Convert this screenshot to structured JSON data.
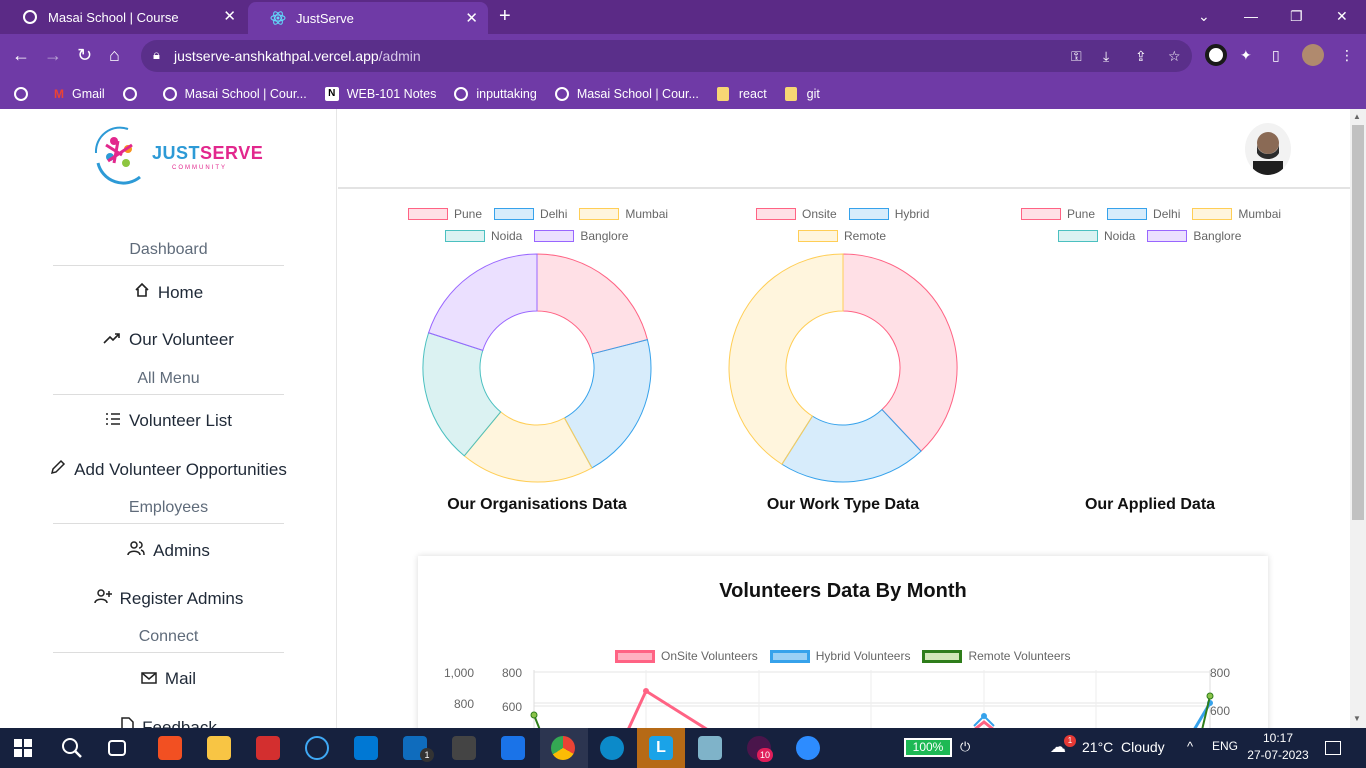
{
  "browser": {
    "tabs": [
      {
        "title": "Masai School | Course",
        "active": false
      },
      {
        "title": "JustServe",
        "active": true
      }
    ],
    "url_host": "justserve-anshkathpal.vercel.app",
    "url_path": "/admin",
    "bookmarks": [
      {
        "label": "Gmail",
        "icon": "gmail-icon"
      },
      {
        "label": "",
        "icon": "globe-icon"
      },
      {
        "label": "Masai School | Cour...",
        "icon": "globe-icon"
      },
      {
        "label": "WEB-101 Notes",
        "icon": "notion-icon"
      },
      {
        "label": "inputtaking",
        "icon": "globe-icon"
      },
      {
        "label": "Masai School | Cour...",
        "icon": "globe-icon"
      },
      {
        "label": "react",
        "icon": "folder-icon"
      },
      {
        "label": "git",
        "icon": "folder-icon"
      }
    ]
  },
  "sidebar": {
    "logo": {
      "brand_a": "JUST",
      "brand_b": "SERVE",
      "sub": "COMMUNITY"
    },
    "sections": [
      {
        "title": "Dashboard",
        "items": [
          {
            "label": "Home",
            "icon": "home-icon"
          },
          {
            "label": "Our Volunteer",
            "icon": "trend-icon"
          }
        ]
      },
      {
        "title": "All Menu",
        "items": [
          {
            "label": "Volunteer List",
            "icon": "list-icon"
          },
          {
            "label": "Add Volunteer Opportunities",
            "icon": "pencil-icon"
          }
        ]
      },
      {
        "title": "Employees",
        "items": [
          {
            "label": "Admins",
            "icon": "users-icon"
          },
          {
            "label": "Register Admins",
            "icon": "user-plus-icon"
          }
        ]
      },
      {
        "title": "Connect",
        "items": [
          {
            "label": "Mail",
            "icon": "mail-icon"
          },
          {
            "label": "Feedback",
            "icon": "file-icon"
          }
        ]
      }
    ]
  },
  "colors": {
    "pink": "#ff6384",
    "blue": "#36a2eb",
    "yellow": "#ffce56",
    "teal": "#4bc0c0",
    "purple": "#9966ff",
    "green": "#2e7d1a"
  },
  "chart_data": [
    {
      "type": "pie",
      "title": "Our Organisations Data",
      "categories": [
        "Pune",
        "Delhi",
        "Mumbai",
        "Noida",
        "Banglore"
      ],
      "values": [
        21,
        21,
        19,
        19,
        20
      ]
    },
    {
      "type": "pie",
      "title": "Our Work Type Data",
      "categories": [
        "Onsite",
        "Hybrid",
        "Remote"
      ],
      "values": [
        38,
        21,
        41
      ]
    },
    {
      "type": "pie",
      "title": "Our Applied Data",
      "categories": [
        "Pune",
        "Delhi",
        "Mumbai",
        "Noida",
        "Banglore"
      ],
      "values": []
    },
    {
      "type": "line",
      "title": "Volunteers Data By Month",
      "series": [
        {
          "name": "OnSite Volunteers"
        },
        {
          "name": "Hybrid Volunteers"
        },
        {
          "name": "Remote Volunteers"
        }
      ],
      "left_ticks_outer": [
        "1,000",
        "800"
      ],
      "left_ticks_inner": [
        "800",
        "600"
      ],
      "right_ticks": [
        "800",
        "600"
      ]
    }
  ],
  "taskbar": {
    "battery": "100%",
    "weather": "21°C  Cloudy",
    "weather_badge": "1",
    "lang": "ENG",
    "time": "10:17",
    "date": "27-07-2023",
    "mail_badge": "1",
    "app_badge": "10"
  }
}
